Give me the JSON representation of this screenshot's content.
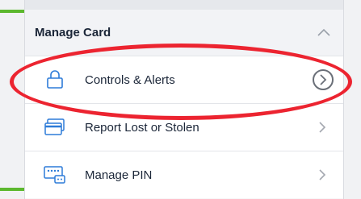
{
  "section": {
    "title": "Manage Card"
  },
  "rows": [
    {
      "label": "Controls & Alerts",
      "icon": "lock-icon"
    },
    {
      "label": "Report Lost or Stolen",
      "icon": "card-icon"
    },
    {
      "label": "Manage PIN",
      "icon": "pin-pad-icon"
    }
  ],
  "colors": {
    "accent_green": "#5cb82e",
    "highlight_red": "#ec2430",
    "icon_blue": "#2d7bd8",
    "text_dark": "#1b2638"
  }
}
